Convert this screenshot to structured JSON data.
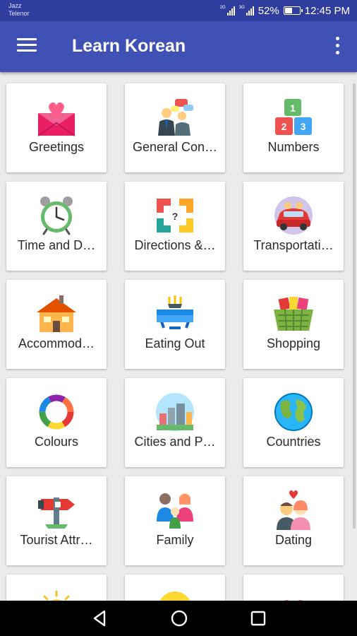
{
  "status_bar": {
    "carrier_1": "Jazz",
    "carrier_2": "Telenor",
    "sim_1_tag": "2G",
    "sim_2_tag": "3G",
    "battery": "52%",
    "battery_level": 0.52,
    "time": "12:45 PM"
  },
  "app_bar": {
    "title": "Learn Korean",
    "menu_icon": "hamburger-menu-icon",
    "overflow_icon": "more-vert-icon",
    "background": "#3f51b5"
  },
  "categories": [
    {
      "label": "Greetings",
      "icon": "envelope-heart-icon"
    },
    {
      "label": "General Con…",
      "icon": "conversation-icon"
    },
    {
      "label": "Numbers",
      "icon": "number-blocks-icon"
    },
    {
      "label": "Time and D…",
      "icon": "alarm-clock-icon"
    },
    {
      "label": "Directions &…",
      "icon": "directions-arrows-icon"
    },
    {
      "label": "Transportati…",
      "icon": "car-icon"
    },
    {
      "label": "Accommod…",
      "icon": "house-icon"
    },
    {
      "label": "Eating Out",
      "icon": "dining-table-icon"
    },
    {
      "label": "Shopping",
      "icon": "shopping-basket-icon"
    },
    {
      "label": "Colours",
      "icon": "color-wheel-icon"
    },
    {
      "label": "Cities and P…",
      "icon": "city-icon"
    },
    {
      "label": "Countries",
      "icon": "globe-icon"
    },
    {
      "label": "Tourist Attr…",
      "icon": "signpost-icon"
    },
    {
      "label": "Family",
      "icon": "family-icon"
    },
    {
      "label": "Dating",
      "icon": "couple-icon"
    },
    {
      "label": "",
      "icon": "sun-icon"
    },
    {
      "label": "",
      "icon": "smiley-icon"
    },
    {
      "label": "",
      "icon": "lips-icon"
    }
  ],
  "nav_bar": {
    "back_icon": "back-triangle-icon",
    "home_icon": "home-circle-icon",
    "recents_icon": "recents-square-icon"
  }
}
